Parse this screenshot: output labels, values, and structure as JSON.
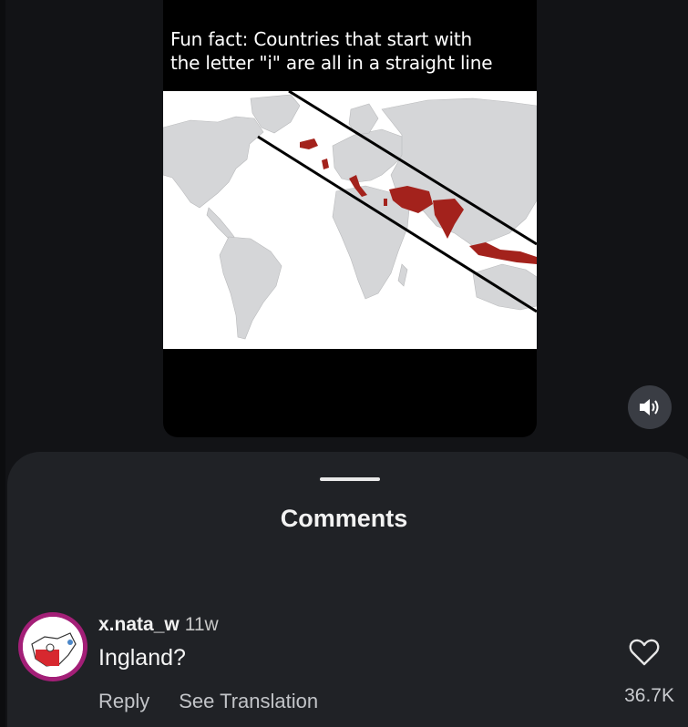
{
  "post": {
    "caption": "Fun fact: Countries that start with\nthe letter \"i\" are all in a straight line"
  },
  "controls": {
    "mute_icon": "speaker-icon"
  },
  "comments_sheet": {
    "title": "Comments",
    "comments": [
      {
        "username": "x.nata_w",
        "time": "11w",
        "text": "Ingland?",
        "reply_label": "Reply",
        "translate_label": "See Translation",
        "likes": "36.7K",
        "like_icon": "heart-icon"
      }
    ]
  },
  "colors": {
    "background": "#121316",
    "sheet": "#202226",
    "highlight_country": "#a3221c",
    "avatar_ring": "#a31f77"
  }
}
